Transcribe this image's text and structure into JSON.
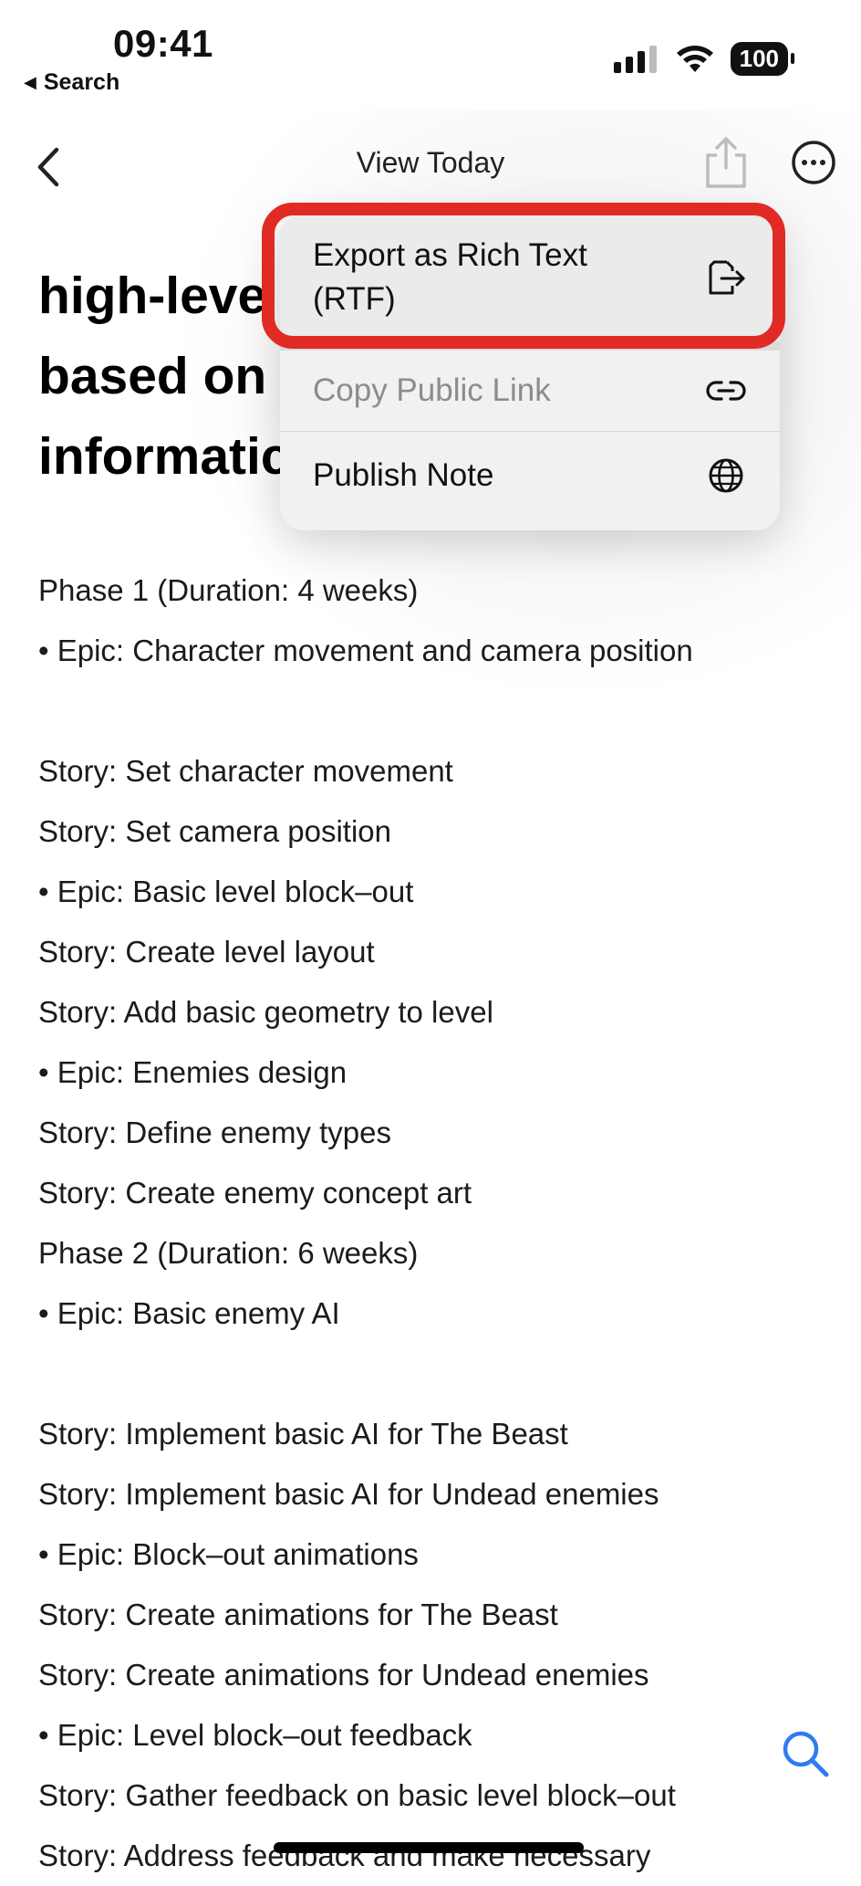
{
  "status_bar": {
    "time": "09:41",
    "back_app": "Search",
    "battery": "100"
  },
  "nav": {
    "title": "View Today"
  },
  "note": {
    "title_lines": [
      "high-leve",
      "based on",
      "informatic"
    ],
    "lines": [
      "Phase 1 (Duration: 4 weeks)",
      "• Epic: Character movement and camera position",
      "",
      "Story: Set character movement",
      "Story: Set camera position",
      "• Epic: Basic level block–out",
      "Story: Create level layout",
      "Story: Add basic geometry to level",
      "• Epic: Enemies design",
      "Story: Define enemy types",
      "Story: Create enemy concept art",
      "Phase 2 (Duration: 6 weeks)",
      "• Epic: Basic enemy AI",
      "",
      "Story: Implement basic AI for The Beast",
      "Story: Implement basic AI for Undead enemies",
      "• Epic: Block–out animations",
      "Story: Create animations for The Beast",
      "Story: Create animations for Undead enemies",
      "• Epic: Level block–out feedback",
      "Story: Gather feedback on basic level block–out",
      "Story: Address feedback and make necessary"
    ]
  },
  "menu": {
    "export_line1": "Export as Rich Text",
    "export_line2": "(RTF)",
    "copy_link": "Copy Public Link",
    "publish": "Publish Note"
  },
  "colors": {
    "highlight": "#e02a23",
    "accent_blue": "#2f7bf6"
  },
  "icons": {
    "back": "chevron-left-icon",
    "share": "share-icon",
    "more": "ellipsis-circle-icon",
    "export": "export-document-icon",
    "link": "link-icon",
    "publish": "globe-icon",
    "search": "search-icon"
  }
}
